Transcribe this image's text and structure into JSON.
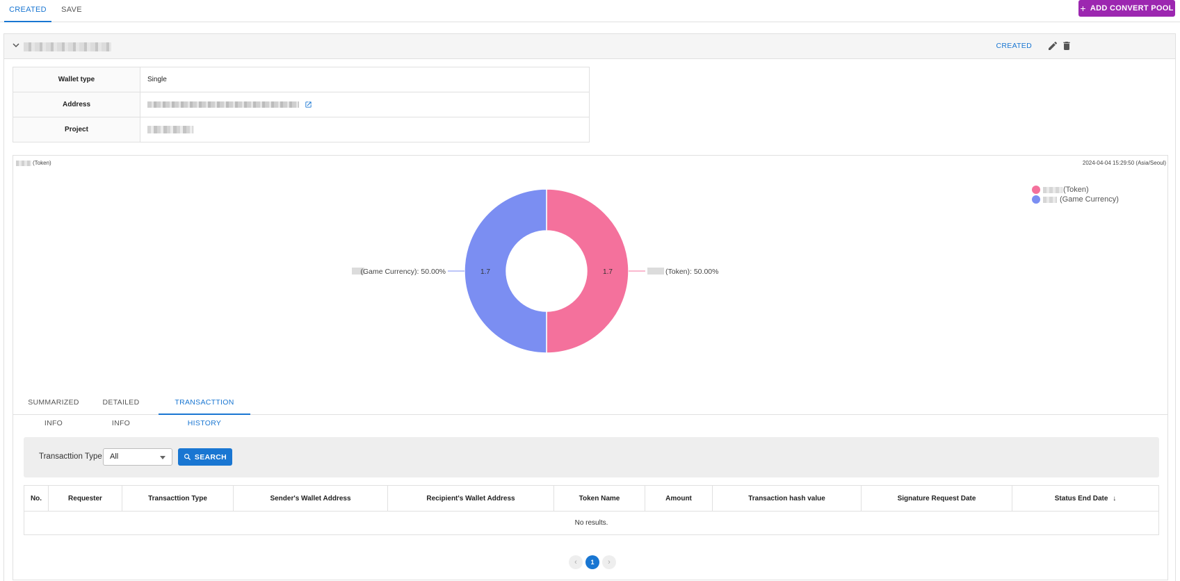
{
  "top_tabs": [
    {
      "label": "CREATED",
      "active": true
    },
    {
      "label": "SAVE",
      "active": false
    }
  ],
  "add_button_label": "ADD CONVERT POOL",
  "card": {
    "status_label": "CREATED",
    "info": [
      {
        "key": "Wallet type",
        "value": "Single"
      },
      {
        "key": "Address",
        "value": ""
      },
      {
        "key": "Project",
        "value": ""
      }
    ]
  },
  "chart_header": {
    "title_suffix": "(Token)",
    "timestamp": "2024-04-04 15:29:50 (Asia/Seoul)"
  },
  "legend": [
    {
      "label": "(Token)"
    },
    {
      "label": "(Game Currency)"
    }
  ],
  "chart_data": {
    "type": "pie",
    "donut": true,
    "slices": [
      {
        "label": "(Token)",
        "value": 1.7,
        "percent": "50.00%",
        "color": "#f4719c"
      },
      {
        "label": "(Game Currency)",
        "value": 1.7,
        "percent": "50.00%",
        "color": "#7b8ef2"
      }
    ],
    "legend_position": "top-right"
  },
  "inner_tabs": [
    {
      "label": "SUMMARIZED INFO",
      "active": false
    },
    {
      "label": "DETAILED INFO",
      "active": false
    },
    {
      "label": "TRANSACTTION HISTORY",
      "active": true
    }
  ],
  "filter": {
    "label": "Transacttion Type",
    "selected": "All",
    "search_label": "SEARCH"
  },
  "table": {
    "columns": [
      "No.",
      "Requester",
      "Transacttion Type",
      "Sender's Wallet Address",
      "Recipient's Wallet Address",
      "Token Name",
      "Amount",
      "Transaction hash value",
      "Signature Request Date",
      "Status End Date"
    ],
    "empty_text": "No results."
  },
  "pagination": {
    "current": "1"
  },
  "colors": {
    "primary": "#1976d2",
    "accent": "#9c27b0",
    "token": "#f4719c",
    "game_currency": "#7b8ef2"
  }
}
